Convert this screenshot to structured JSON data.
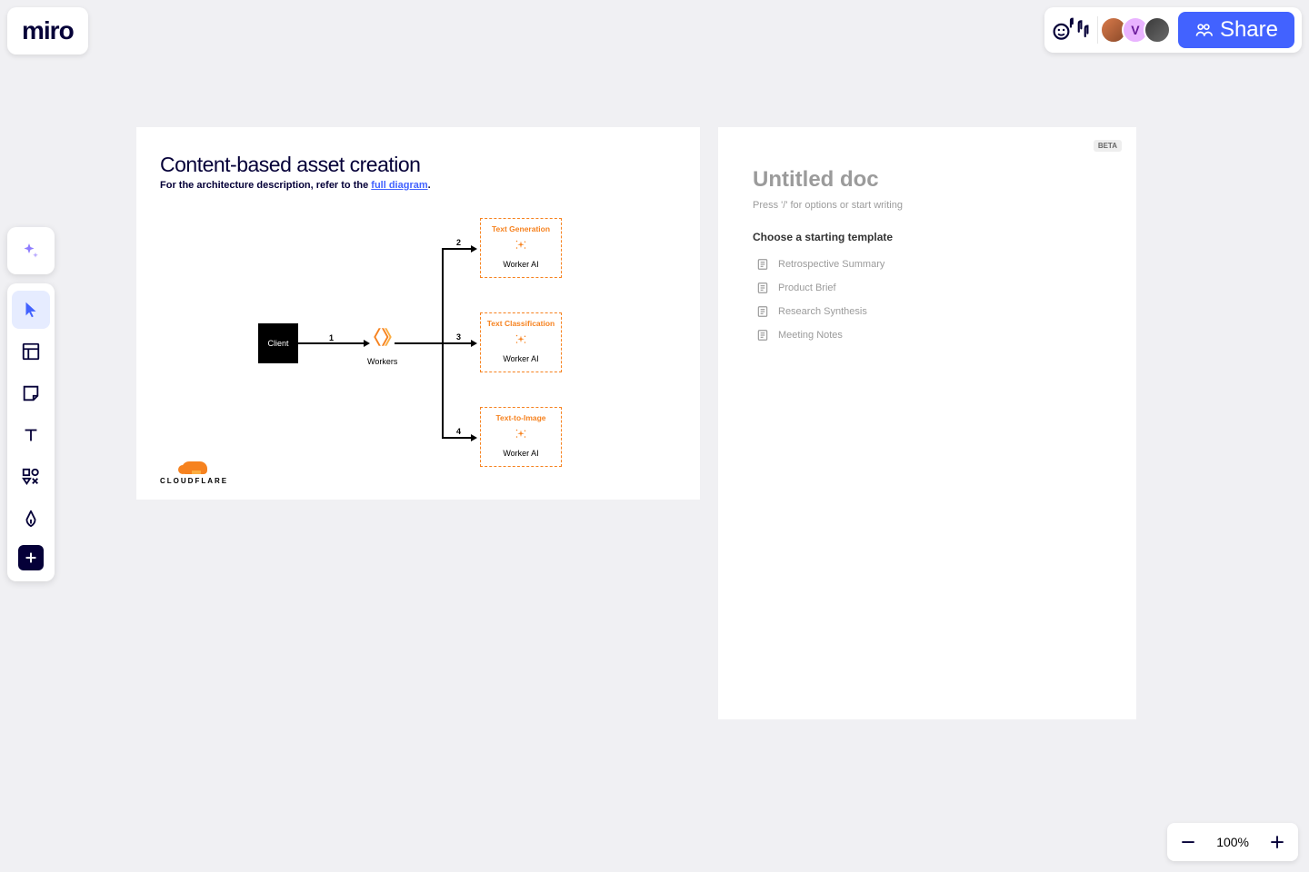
{
  "brand": "miro",
  "topbar": {
    "share_label": "Share",
    "reactions_text": "♪♩♫"
  },
  "toolbar": {
    "tools": [
      "ai",
      "select",
      "frame",
      "sticky",
      "text",
      "shapes",
      "pen",
      "more"
    ]
  },
  "frame": {
    "title": "Content-based asset creation",
    "subtitle_prefix": "For the architecture description, refer to the ",
    "subtitle_link": "full diagram",
    "subtitle_suffix": ".",
    "client": "Client",
    "workers": "Workers",
    "worker_ai": "Worker AI",
    "boxes": [
      {
        "title": "Text Generation"
      },
      {
        "title": "Text Classification"
      },
      {
        "title": "Text-to-Image"
      }
    ],
    "edge_labels": [
      "1",
      "2",
      "3",
      "4"
    ],
    "logo": "CLOUDFLARE"
  },
  "doc": {
    "badge": "BETA",
    "title": "Untitled doc",
    "hint": "Press '/' for options or start writing",
    "choose": "Choose a starting template",
    "templates": [
      "Retrospective Summary",
      "Product Brief",
      "Research Synthesis",
      "Meeting Notes"
    ]
  },
  "zoom": {
    "level": "100%"
  }
}
